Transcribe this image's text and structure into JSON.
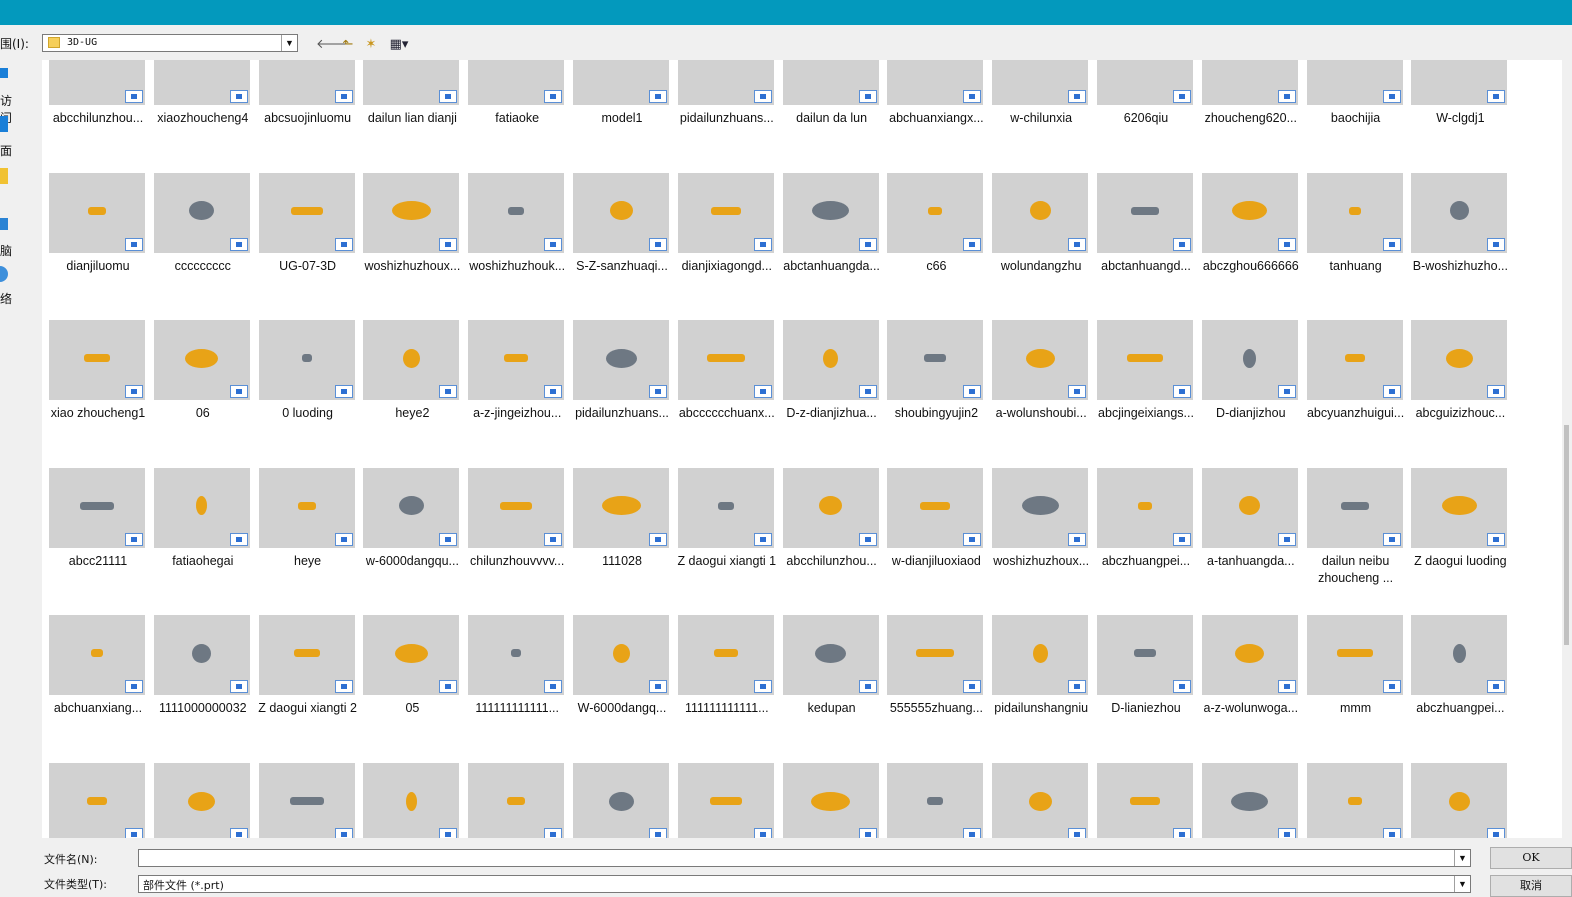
{
  "toolbar": {
    "look_in_label": "围(I):",
    "look_in_value": "3D-UG",
    "back_glyph": "🡐",
    "up_glyph": "⬑",
    "newfolder_glyph": "✶",
    "view_glyph": "▦▾"
  },
  "places": [
    {
      "label": "访问",
      "icon": "recent-places-icon"
    },
    {
      "label": "面",
      "icon": "desktop-icon"
    },
    {
      "label": "",
      "icon": "library-folder-icon"
    },
    {
      "label": "脑",
      "icon": "computer-icon"
    },
    {
      "label": "络",
      "icon": "network-icon"
    }
  ],
  "files": [
    "abcchilunzhou...",
    "xiaozhoucheng4",
    "abcsuojinluomu",
    "dailun  lian dianji",
    "fatiaoke",
    "model1",
    "pidailunzhuans...",
    "dailun    da  lun",
    "abchuanxiangx...",
    "w-chilunxia",
    "6206qiu",
    "zhoucheng620...",
    "baochijia",
    "W-clgdj1",
    "dianjiluomu",
    "ccccccccc",
    "UG-07-3D",
    "woshizhuzhoux...",
    "woshizhuzhouk...",
    "S-Z-sanzhuaqi...",
    "dianjixiagongd...",
    "abctanhuangda...",
    "c66",
    "wolundangzhu",
    "abctanhuangd...",
    "abczghou666666",
    "tanhuang",
    "B-woshizhuzho...",
    "xiao zhoucheng1",
    "06",
    "0 luoding",
    "heye2",
    "a-z-jingeizhou...",
    "pidailunzhuans...",
    "abcccccchuanx...",
    "D-z-dianjizhua...",
    "shoubingyujin2",
    "a-wolunshoubi...",
    "abcjingeixiangs...",
    "D-dianjizhou",
    "abcyuanzhuigui...",
    "abcguizizhouc...",
    "abcc21111",
    "fatiaohegai",
    "heye",
    "w-6000dangqu...",
    "chilunzhouvvvv...",
    "111028",
    "Z  daogui   xiangti 1",
    "abcchilunzhou...",
    "w-dianjiluoxiaod",
    "woshizhuzhoux...",
    "abczhuangpei...",
    "a-tanhuangda...",
    "dailun  neibu zhoucheng  ...",
    "Z  daogui luoding",
    "abchuanxiang...",
    "1111000000032",
    "Z  daogui xiangti 2",
    "05",
    "111111111111...",
    "W-6000dangq...",
    "111111111111...",
    "kedupan",
    "555555zhuang...",
    "pidailunshangniu",
    "D-lianiezhou",
    "a-z-wolunwoga...",
    "mmm",
    "abczhuangpei...",
    "",
    "",
    "",
    "",
    "",
    "",
    "",
    "",
    "",
    "",
    "",
    "",
    "",
    ""
  ],
  "bottom": {
    "filename_label": "文件名(N):",
    "filename_value": "",
    "filetype_label": "文件类型(T):",
    "filetype_value": "部件文件 (*.prt)",
    "ok_label": "OK",
    "cancel_label": "取消"
  },
  "colors": {
    "titlebar": "#0399bd",
    "thumb_bg": "#d1d1d1",
    "part_gold": "#e8a317",
    "part_gray": "#6e7883"
  }
}
